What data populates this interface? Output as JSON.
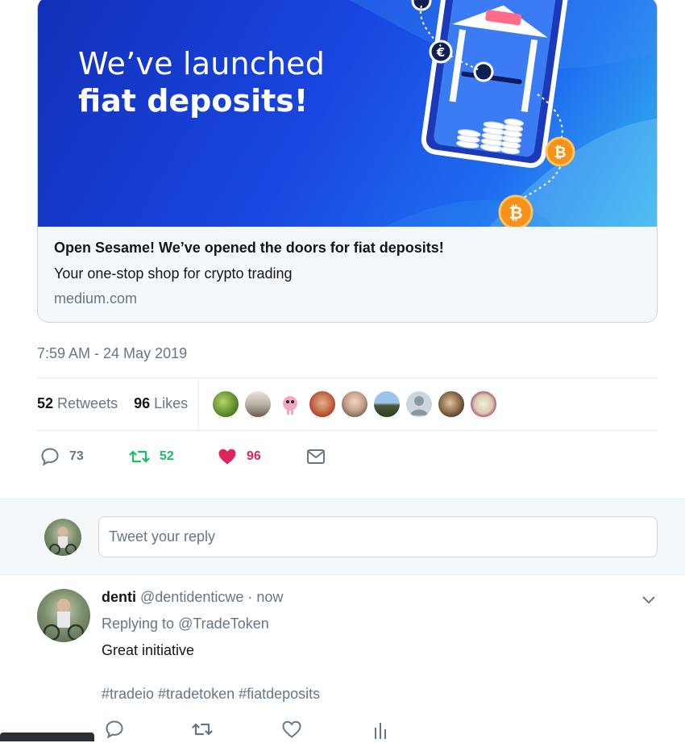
{
  "card": {
    "banner_line1": "We’ve launched",
    "banner_line2": "fiat deposits!",
    "banner_bank_label": "BANK",
    "title": "Open Sesame! We’ve opened the doors for fiat deposits!",
    "description": "Your one-stop shop for crypto trading",
    "domain": "medium.com"
  },
  "tweet": {
    "timestamp": "7:59 AM - 24 May 2019",
    "retweets_count": "52",
    "retweets_label": "Retweets",
    "likes_count": "96",
    "likes_label": "Likes"
  },
  "actions": {
    "reply_count": "73",
    "retweet_count": "52",
    "like_count": "96"
  },
  "reply_box": {
    "placeholder": "Tweet your reply"
  },
  "reply": {
    "name": "denti",
    "handle": "@dentidenticwe",
    "separator": "·",
    "time": "now",
    "replying_prefix": "Replying to",
    "replying_to": "@TradeToken",
    "text": "Great initiative",
    "hashtags": "#tradeio #tradetoken #fiatdeposits"
  },
  "colors": {
    "retweet_green": "#17bf63",
    "like_red": "#e0245e",
    "muted_gray": "#657786",
    "banner_blue": "#1846e0"
  },
  "icons": [
    "reply-icon",
    "retweet-icon",
    "heart-icon",
    "mail-icon",
    "chevron-down-icon",
    "analytics-icon"
  ]
}
